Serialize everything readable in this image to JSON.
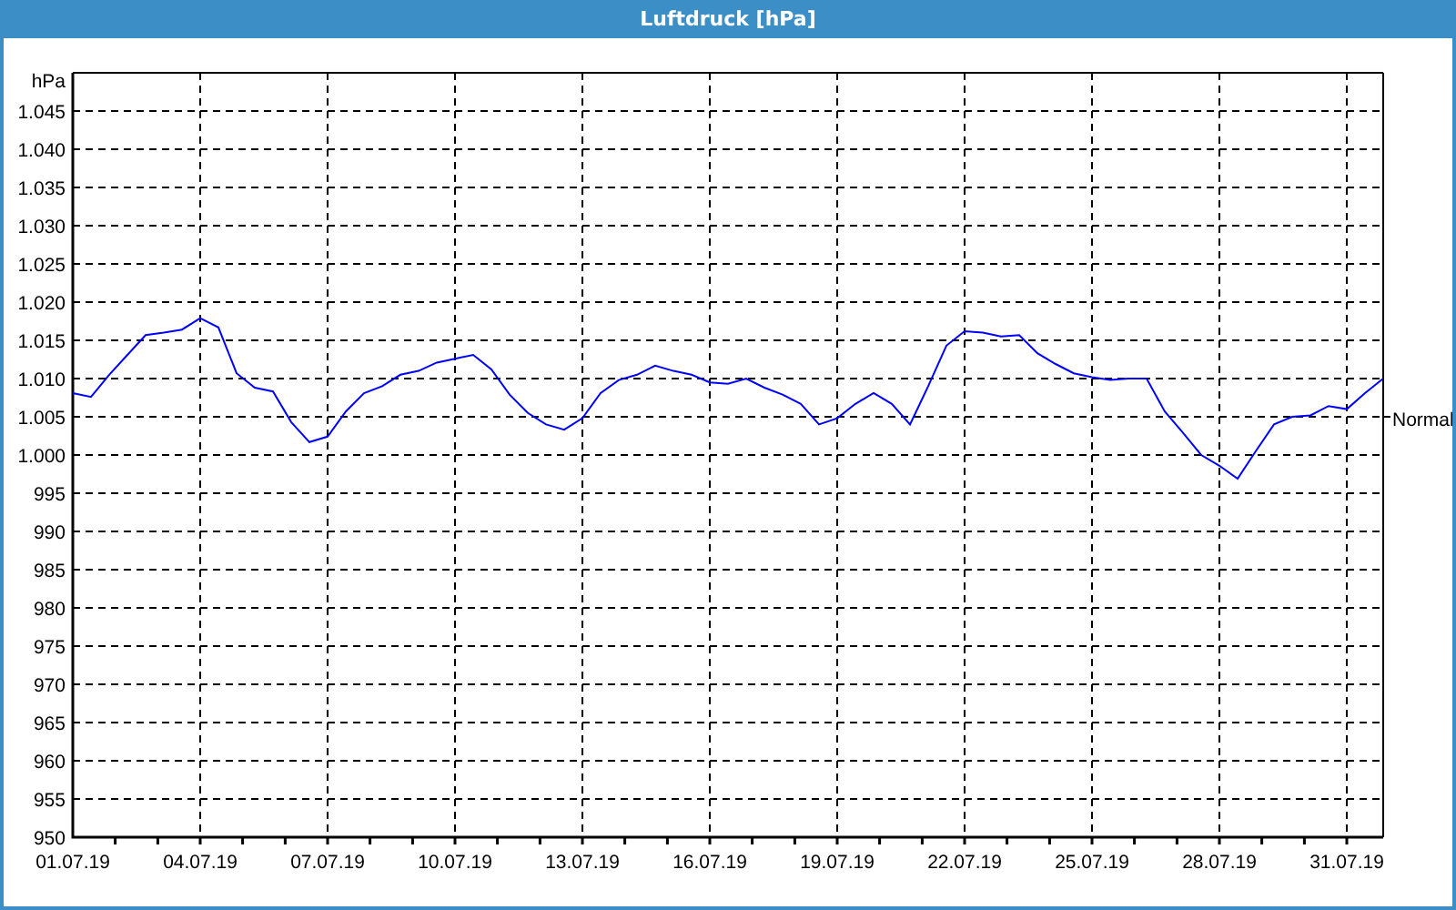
{
  "window": {
    "title": "Luftdruck [hPa]"
  },
  "chart": {
    "chart_data": {
      "type": "line",
      "ylabel": "hPa",
      "categories": [
        "01.07.19",
        null,
        null,
        null,
        null,
        null,
        null,
        "04.07.19",
        null,
        null,
        null,
        null,
        null,
        null,
        "07.07.19",
        null,
        null,
        null,
        null,
        null,
        null,
        "10.07.19",
        null,
        null,
        null,
        null,
        null,
        null,
        "13.07.19",
        null,
        null,
        null,
        null,
        null,
        null,
        "16.07.19",
        null,
        null,
        null,
        null,
        null,
        null,
        "19.07.19",
        null,
        null,
        null,
        null,
        null,
        null,
        "22.07.19",
        null,
        null,
        null,
        null,
        null,
        null,
        "25.07.19",
        null,
        null,
        null,
        null,
        null,
        null,
        "28.07.19",
        null,
        null,
        null,
        null,
        null,
        null,
        "31.07.19",
        null,
        null
      ],
      "series": [
        {
          "color": "#0000ff",
          "values": [
            1008.1,
            1007.6,
            1010.5,
            1013.1,
            1015.7,
            1016.0,
            1016.4,
            1017.9,
            1016.7,
            1010.7,
            1008.8,
            1008.3,
            1004.3,
            1001.7,
            1002.4,
            1005.7,
            1008.1,
            1009.0,
            1010.5,
            1011.0,
            1012.1,
            1012.6,
            1013.1,
            1011.2,
            1007.9,
            1005.5,
            1004.0,
            1003.3,
            1004.8,
            1008.1,
            1009.8,
            1010.5,
            1011.7,
            1011.0,
            1010.5,
            1009.5,
            1009.3,
            1010.0,
            1008.8,
            1007.9,
            1006.7,
            1004.0,
            1004.8,
            1006.7,
            1008.1,
            1006.7,
            1004.0,
            1009.0,
            1014.3,
            1016.2,
            1016.0,
            1015.5,
            1015.7,
            1013.3,
            1011.9,
            1010.7,
            1010.2,
            1009.8,
            1010.0,
            1010.0,
            1005.7,
            1002.9,
            1000.0,
            998.6,
            996.9,
            1000.5,
            1004.0,
            1005.0,
            1005.2,
            1006.4,
            1006.0,
            1008.1,
            1010.0
          ]
        }
      ],
      "grid": true,
      "ylim": [
        950,
        1050
      ],
      "yticks": [
        {
          "value": 950,
          "label": "950"
        },
        {
          "value": 955,
          "label": "955"
        },
        {
          "value": 960,
          "label": "960"
        },
        {
          "value": 965,
          "label": "965"
        },
        {
          "value": 970,
          "label": "970"
        },
        {
          "value": 975,
          "label": "975"
        },
        {
          "value": 980,
          "label": "980"
        },
        {
          "value": 985,
          "label": "985"
        },
        {
          "value": 990,
          "label": "990"
        },
        {
          "value": 995,
          "label": "995"
        },
        {
          "value": 1000,
          "label": "1.000"
        },
        {
          "value": 1005,
          "label": "1.005"
        },
        {
          "value": 1010,
          "label": "1.010"
        },
        {
          "value": 1015,
          "label": "1.015"
        },
        {
          "value": 1020,
          "label": "1.020"
        },
        {
          "value": 1025,
          "label": "1.025"
        },
        {
          "value": 1030,
          "label": "1.030"
        },
        {
          "value": 1035,
          "label": "1.035"
        },
        {
          "value": 1040,
          "label": "1.040"
        },
        {
          "value": 1045,
          "label": "1.045"
        }
      ],
      "annotations": [
        "Normal"
      ]
    }
  }
}
